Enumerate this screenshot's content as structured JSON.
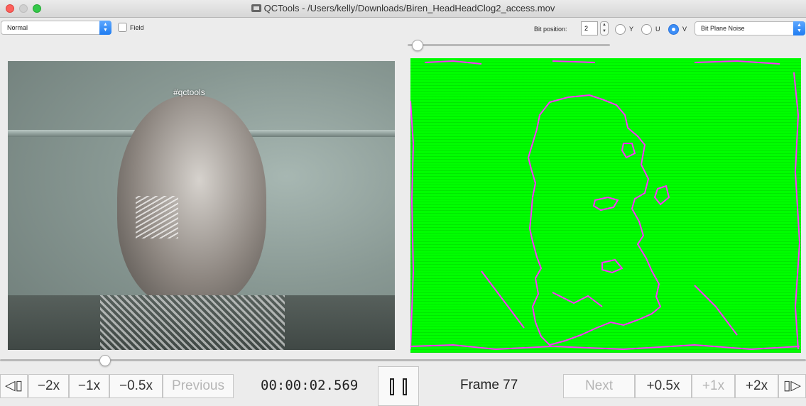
{
  "window": {
    "title": "QCTools - /Users/kelly/Downloads/Biren_HeadHeadClog2_access.mov"
  },
  "toolbar": {
    "mode_select": "Normal",
    "field_label": "Field",
    "bit_position_label": "Bit position:",
    "bit_position_value": "2",
    "radio_y": "Y",
    "radio_u": "U",
    "radio_v": "V",
    "selected_plane": "V",
    "filter_select": "Bit Plane Noise",
    "filter_slider_value": 0.05
  },
  "player": {
    "overlay_text": "#qctools",
    "seek_position_fraction": 0.13
  },
  "transport": {
    "prev_frame_label": "◁▯",
    "minus2x": "−2x",
    "minus1x": "−1x",
    "minus05x": "−0.5x",
    "previous": "Previous",
    "timecode": "00:00:02.569",
    "frame_label": "Frame 77",
    "next": "Next",
    "plus05x": "+0.5x",
    "plus1x": "+1x",
    "plus2x": "+2x",
    "next_frame_label": "▯▷"
  },
  "colors": {
    "bitplane_background": "#00ff00",
    "bitplane_edges": "#ff33ff",
    "accent": "#1f7cf1"
  }
}
